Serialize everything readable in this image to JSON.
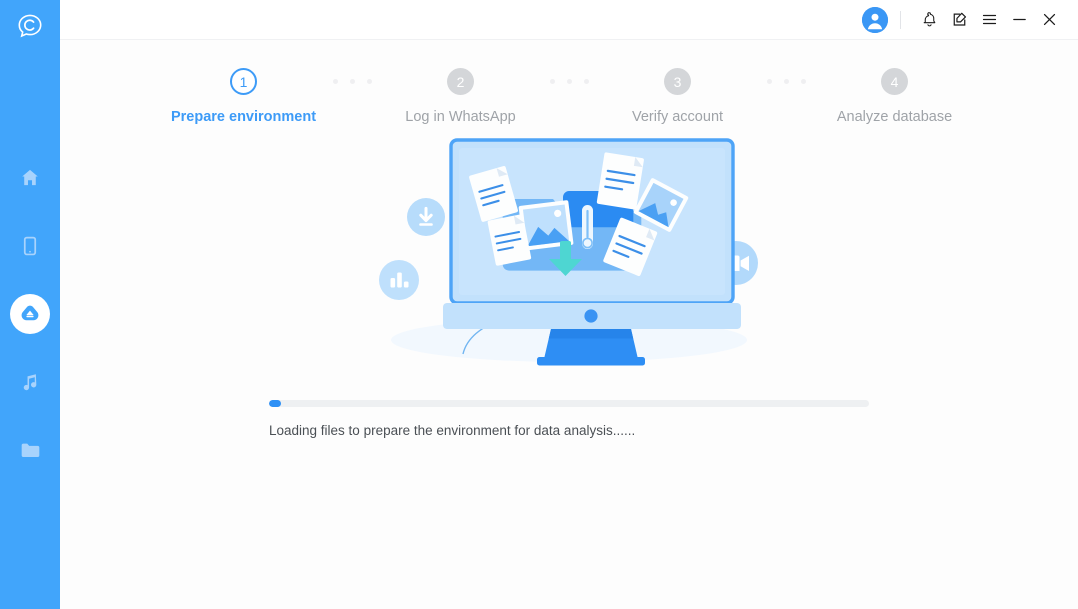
{
  "app": {
    "logo_icon": "speech-bubble-c-logo",
    "accent_color": "#41a5fb",
    "sidebar_bg": "#41a5fb",
    "step_active_color": "#3d9bf7",
    "step_pending_color": "#d4d6d9",
    "progress_fill_color": "#2e90f5"
  },
  "sidebar": {
    "items": [
      {
        "name": "home",
        "icon": "home-icon",
        "active": false
      },
      {
        "name": "phone",
        "icon": "phone-icon",
        "active": false
      },
      {
        "name": "recover",
        "icon": "cloud-recover-icon",
        "active": true
      },
      {
        "name": "music",
        "icon": "music-note-icon",
        "active": false
      },
      {
        "name": "files",
        "icon": "folder-icon",
        "active": false
      }
    ]
  },
  "titlebar": {
    "buttons": [
      {
        "name": "account",
        "icon": "user-avatar-icon",
        "label": ""
      },
      {
        "name": "notifications",
        "icon": "bell-icon",
        "label": ""
      },
      {
        "name": "feedback",
        "icon": "edit-square-icon",
        "label": ""
      },
      {
        "name": "menu",
        "icon": "hamburger-menu-icon",
        "label": ""
      },
      {
        "name": "minimize",
        "icon": "minimize-icon",
        "label": ""
      },
      {
        "name": "close",
        "icon": "close-icon",
        "label": ""
      }
    ]
  },
  "stepper": {
    "steps": [
      {
        "number": "1",
        "label": "Prepare environment",
        "state": "current"
      },
      {
        "number": "2",
        "label": "Log in WhatsApp",
        "state": "pending"
      },
      {
        "number": "3",
        "label": "Verify account",
        "state": "pending"
      },
      {
        "number": "4",
        "label": "Analyze database",
        "state": "pending"
      }
    ]
  },
  "illustration": {
    "name": "data-transfer-monitor-illustration",
    "badges": [
      {
        "name": "download-badge",
        "icon": "download-arrow-icon"
      },
      {
        "name": "analytics-badge",
        "icon": "bar-chart-icon"
      },
      {
        "name": "video-badge",
        "icon": "video-camera-icon"
      }
    ]
  },
  "progress": {
    "percent": 2,
    "percent_label": "2%",
    "status_text": "Loading files to prepare the environment for data analysis......"
  }
}
